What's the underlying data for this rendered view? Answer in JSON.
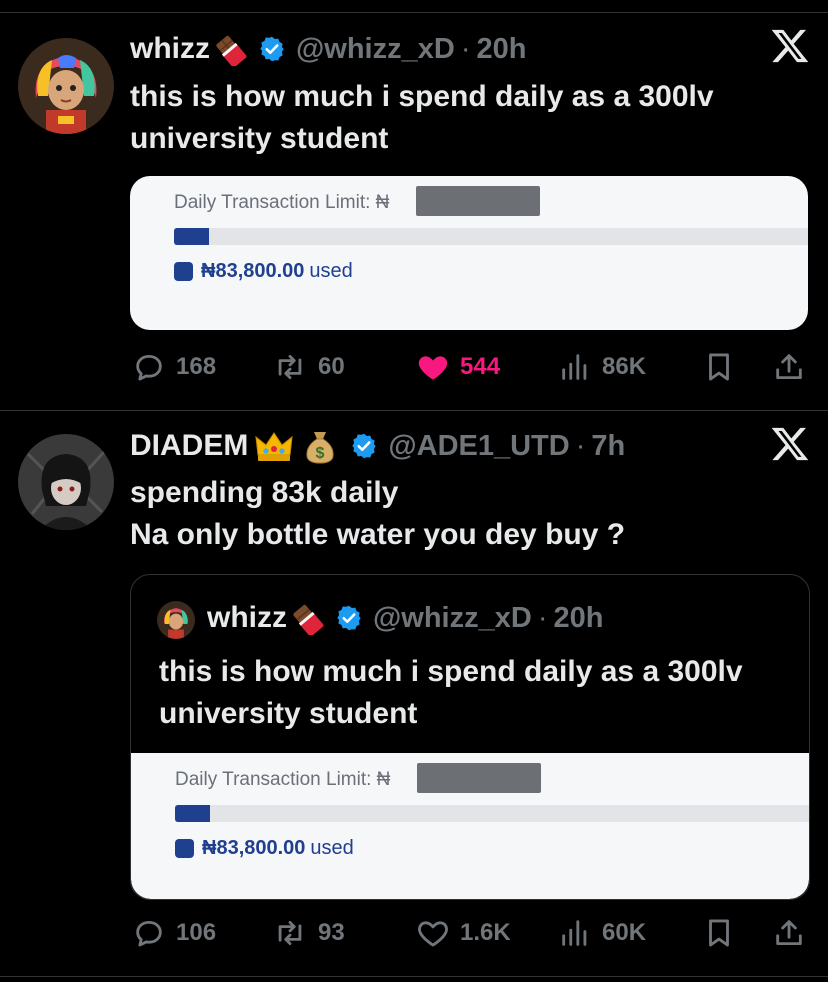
{
  "tweets": [
    {
      "name": "whizz",
      "handle": "@whizz_xD",
      "separator": "·",
      "time": "20h",
      "text_lines": [
        "this is how much i spend daily as a 300lv",
        "university student"
      ],
      "card": {
        "limit_label": "Daily Transaction Limit: ₦",
        "used_amount": "₦83,800.00",
        "used_word": "used",
        "progress_fraction": 0.055
      },
      "stats": {
        "replies": "168",
        "reposts": "60",
        "likes": "544",
        "views": "86K"
      },
      "liked": true
    },
    {
      "name": "DIADEM",
      "handle": "@ADE1_UTD",
      "separator": "·",
      "time": "7h",
      "text_lines": [
        "spending 83k daily",
        "Na only bottle water you dey buy ?"
      ],
      "quote": {
        "name": "whizz",
        "handle": "@whizz_xD",
        "separator": "·",
        "time": "20h",
        "text_lines": [
          "this is how much i spend daily as a 300lv",
          "university student"
        ],
        "card": {
          "limit_label": "Daily Transaction Limit: ₦",
          "used_amount": "₦83,800.00",
          "used_word": "used",
          "progress_fraction": 0.055
        }
      },
      "stats": {
        "replies": "106",
        "reposts": "93",
        "likes": "1.6K",
        "views": "60K"
      },
      "liked": false
    }
  ],
  "icons": {
    "brand": "x-logo",
    "verified": "verified-badge-icon",
    "emoji_1": "chocolate-bar",
    "emoji_2a": "crown",
    "emoji_2b": "money-bag"
  },
  "colors": {
    "background": "#000000",
    "text": "#e7e9ea",
    "muted": "#71767b",
    "verified": "#1d9bf0",
    "like": "#f91880",
    "bank_blue": "#1f3f8f"
  }
}
